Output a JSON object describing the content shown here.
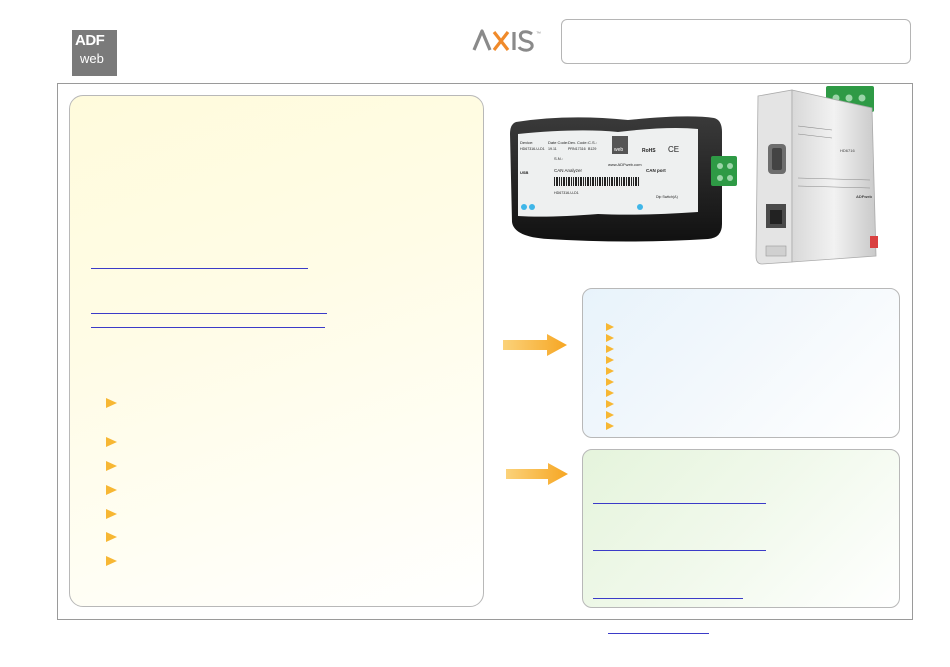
{
  "logos": {
    "adf_top": "ADF",
    "adf_bottom": "web",
    "axis": "AXIS",
    "axis_tm": "™"
  },
  "colors": {
    "bullet": "#f7b733",
    "link_underline": "#3b3bc8",
    "left_panel_bg": "#fffbdc",
    "right_top_bg": "#e8f3fb",
    "right_bottom_bg": "#e5f4dc"
  },
  "analyzer_label": {
    "device": "Device:",
    "device_code": "HD67316-U-D1",
    "date_code": "Date Code:",
    "date_value": "19.11",
    "dev_code": "Dev. Code:",
    "dev_value": "PRN17316",
    "cs": "C.S.:",
    "cs_value": "B129",
    "sn": "S.N.:",
    "brand": "web",
    "rohs": "RoHS",
    "ce": "CE",
    "url": "www.ADFweb.com",
    "product": "CAN Analyzer",
    "port": "CAN port",
    "usb": "USB",
    "dip": "Dip Switch(A)",
    "code_bottom": "HD67316-U-D1"
  },
  "gateway_label": {
    "brand": "ADFweb",
    "fw": "HD6716"
  }
}
